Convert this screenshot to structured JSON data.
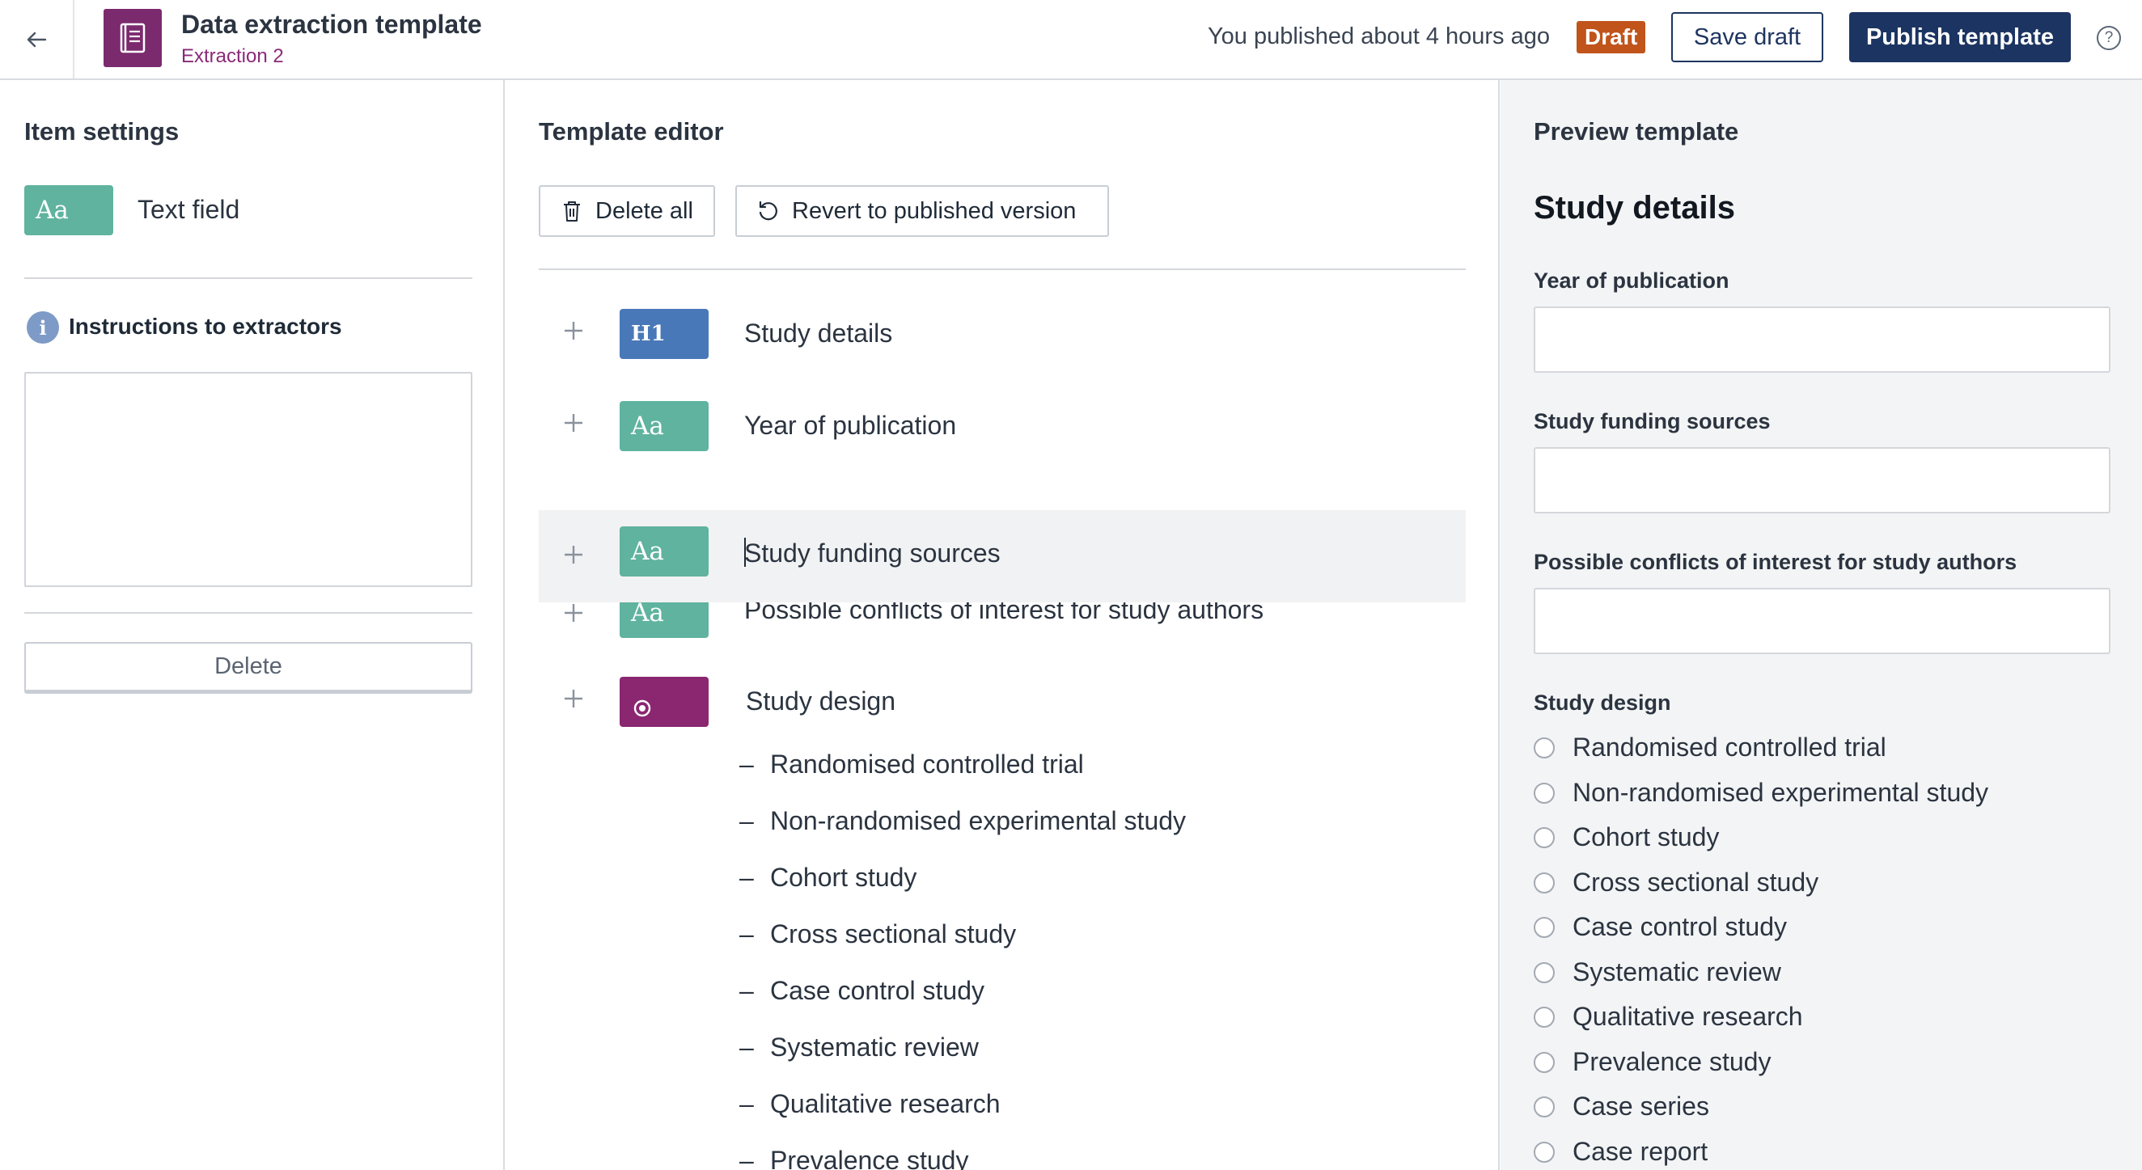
{
  "header": {
    "title": "Data extraction template",
    "subtitle": "Extraction 2",
    "published_status": "You published about 4 hours ago",
    "draft_badge": "Draft",
    "save_draft_label": "Save draft",
    "publish_label": "Publish template",
    "help_symbol": "?"
  },
  "item_settings": {
    "title": "Item settings",
    "type_badge": "Aa",
    "type_label": "Text field",
    "instructions_label": "Instructions to extractors",
    "instructions_value": "",
    "delete_label": "Delete",
    "info_symbol": "i"
  },
  "template_editor": {
    "title": "Template editor",
    "delete_all_label": "Delete all",
    "revert_label": "Revert to published version",
    "items": [
      {
        "type": "heading",
        "badge": "H1",
        "label": "Study details"
      },
      {
        "type": "text",
        "badge": "Aa",
        "label": "Year of publication"
      },
      {
        "type": "text",
        "badge": "Aa",
        "label": "Study funding sources"
      },
      {
        "type": "text",
        "badge": "Aa",
        "label": "Possible conflicts of interest for study authors"
      },
      {
        "type": "radio",
        "badge": "",
        "label": "Study design"
      }
    ],
    "options": [
      "Randomised controlled trial",
      "Non-randomised experimental study",
      "Cohort study",
      "Cross sectional study",
      "Case control study",
      "Systematic review",
      "Qualitative research",
      "Prevalence study"
    ]
  },
  "preview": {
    "title": "Preview template",
    "heading": "Study details",
    "fields": [
      {
        "label": "Year of publication",
        "value": ""
      },
      {
        "label": "Study funding sources",
        "value": ""
      },
      {
        "label": "Possible conflicts of interest for study authors",
        "value": ""
      }
    ],
    "radio_label": "Study design",
    "radio_options": [
      "Randomised controlled trial",
      "Non-randomised experimental study",
      "Cohort study",
      "Cross sectional study",
      "Case control study",
      "Systematic review",
      "Qualitative research",
      "Prevalence study",
      "Case series",
      "Case report"
    ]
  },
  "colors": {
    "brand_purple": "#7b2a6e",
    "navy": "#1c3461",
    "draft_orange": "#c0541a",
    "text_badge_teal": "#5fb39f",
    "heading_badge_blue": "#4878b8",
    "radio_badge_magenta": "#8b2670"
  }
}
